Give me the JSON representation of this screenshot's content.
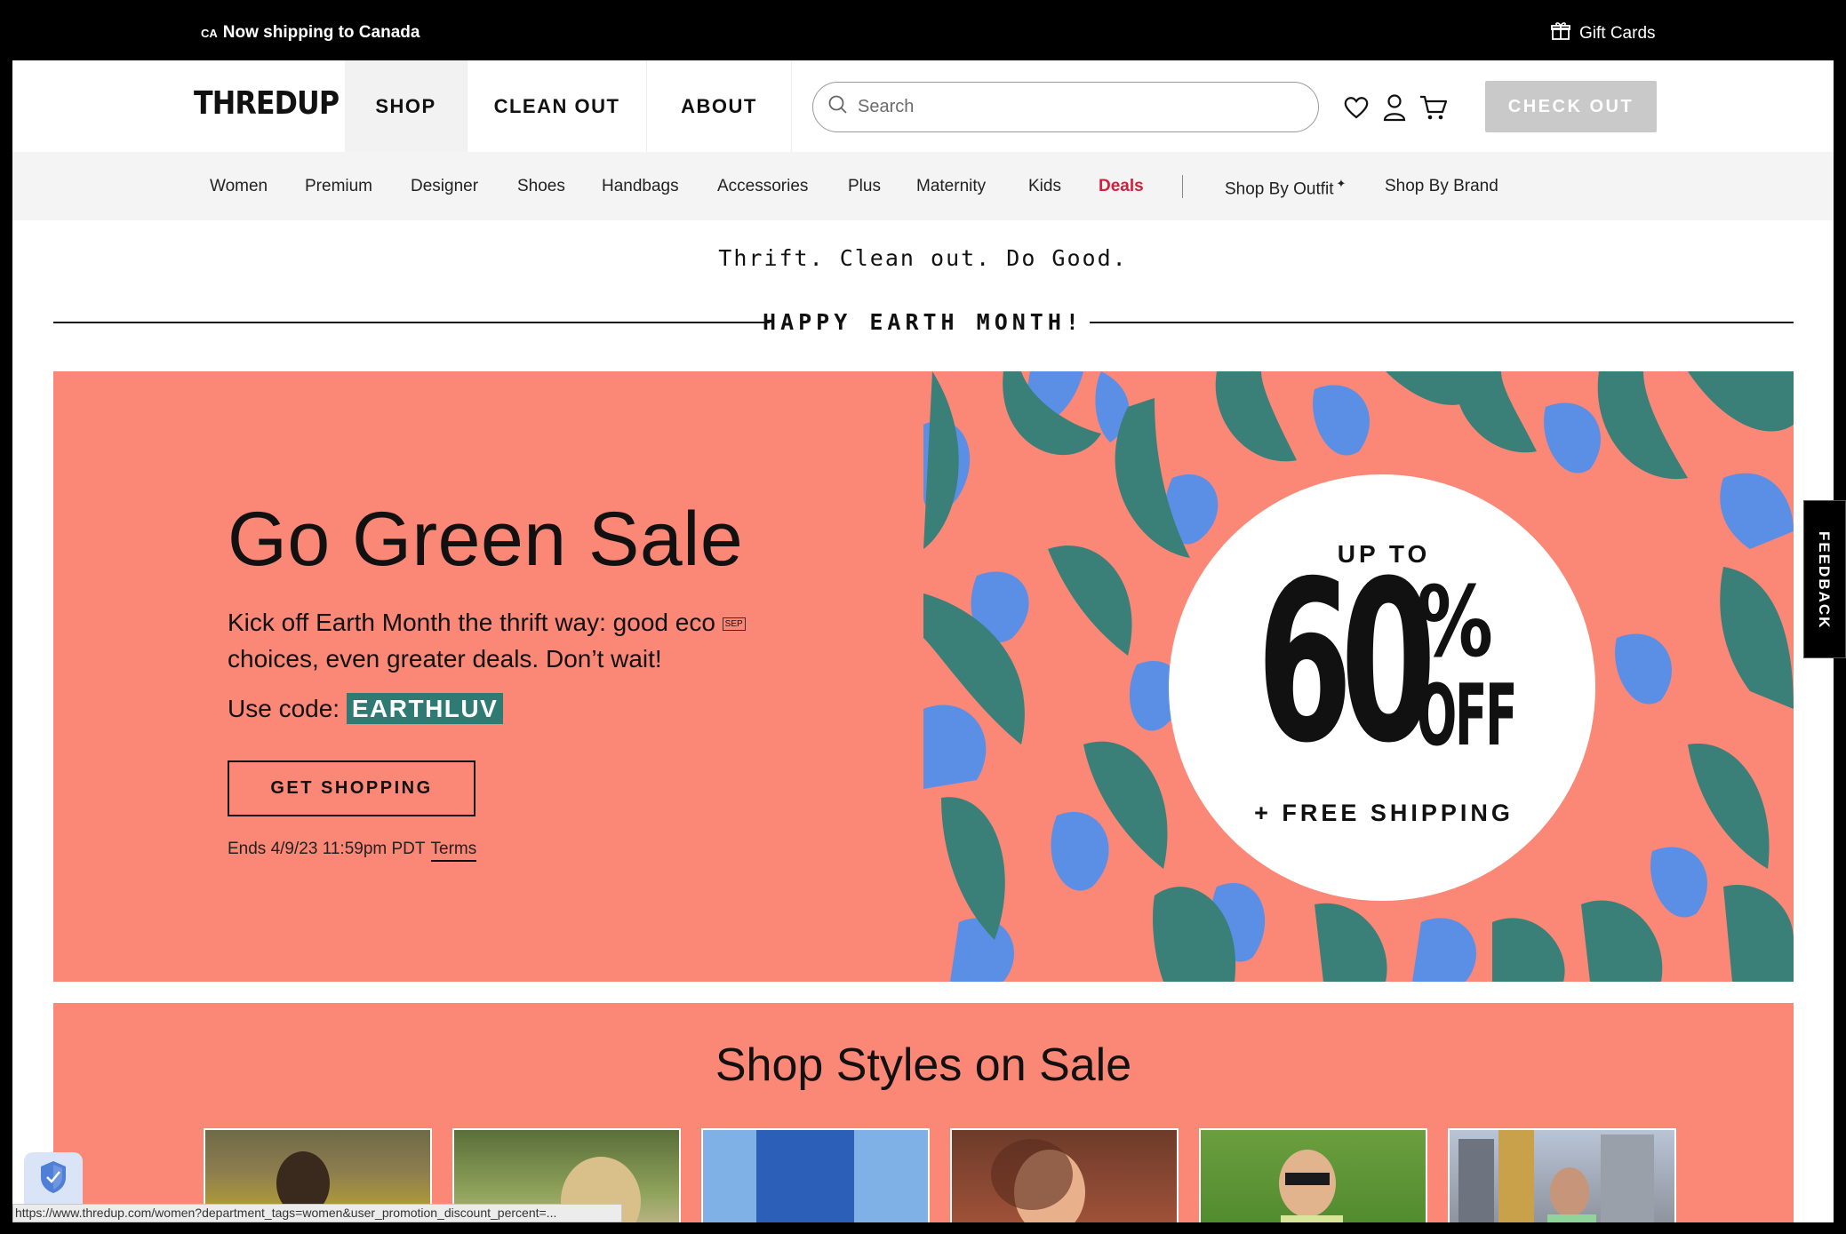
{
  "topbar": {
    "country_code": "CA",
    "shipping_text": "Now shipping to Canada",
    "gift_cards": "Gift Cards"
  },
  "header": {
    "logo": "THREDUP",
    "tabs": [
      {
        "label": "SHOP",
        "active": true
      },
      {
        "label": "CLEAN OUT",
        "active": false
      },
      {
        "label": "ABOUT",
        "active": false
      }
    ],
    "search_placeholder": "Search",
    "checkout_label": "CHECK OUT"
  },
  "subnav": {
    "items": [
      "Women",
      "Premium",
      "Designer",
      "Shoes",
      "Handbags",
      "Accessories",
      "Plus",
      "Maternity",
      "Kids",
      "Deals"
    ],
    "right_items": [
      "Shop By Outfit",
      "Shop By Brand"
    ],
    "outfit_marker": "✦"
  },
  "tagline": "Thrift. Clean out. Do Good.",
  "earth_month": "HAPPY EARTH MONTH!",
  "hero": {
    "title": "Go Green Sale",
    "copy_line1": "Kick off Earth Month the thrift way: good eco ",
    "copy_sep": "SEP",
    "copy_line2": "choices, even greater deals. Don’t wait!",
    "code_label": "Use code:",
    "code": "EARTHLUV",
    "button": "GET SHOPPING",
    "ends": "Ends 4/9/23 11:59pm PDT",
    "terms": "Terms",
    "badge_up_to": "UP TO",
    "badge_percent": "60",
    "badge_percent_sign": "%",
    "badge_off": "OFF",
    "badge_free": "+ FREE SHIPPING"
  },
  "styles_section": {
    "title": "Shop Styles on Sale",
    "thumbnail_count": 6
  },
  "feedback": "FEEDBACK",
  "status_url": "https://www.thredup.com/women?department_tags=women&user_promotion_discount_percent=...",
  "colors": {
    "coral": "#fb8777",
    "teal": "#2f7b73",
    "leaf_teal": "#3a7f78",
    "blue": "#5b8fe6",
    "deals_red": "#d21f3c",
    "checkout_gray": "#c9c9c9"
  }
}
